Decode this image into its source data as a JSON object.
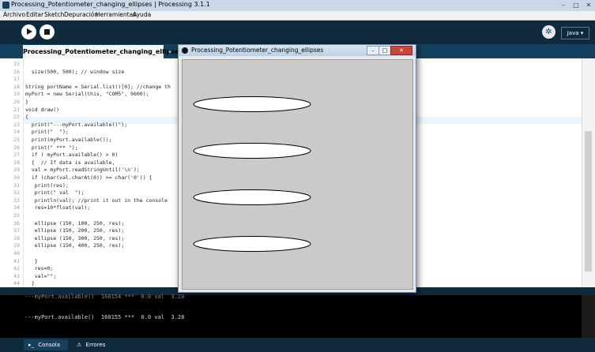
{
  "window": {
    "title": "Processing_Potentiometer_changing_ellipses | Processing 3.1.1",
    "min": "–",
    "max": "□",
    "close": "✕"
  },
  "menu": [
    "Archivo",
    "Editar",
    "Sketch",
    "Depuración",
    "Herramientas",
    "Ayuda"
  ],
  "toolbar": {
    "mode": "Java ▾",
    "debug_icon": "butterfly-icon",
    "run_icon": "play-icon",
    "stop_icon": "stop-icon"
  },
  "tabs": {
    "active": "Processing_Potentiometer_changing_ellipses",
    "arrow": "▾"
  },
  "editor": {
    "highlighted_line": "23",
    "lines": [
      {
        "n": "15",
        "code": ""
      },
      {
        "n": "16",
        "code": "  size(500, 500); // window size"
      },
      {
        "n": "17",
        "code": ""
      },
      {
        "n": "18",
        "code": "String portName = Serial.list()[0]; //change th"
      },
      {
        "n": "19",
        "code": "myPort = new Serial(this, \"COM5\", 9600);"
      },
      {
        "n": "20",
        "code": "}"
      },
      {
        "n": "21",
        "code": "void draw()"
      },
      {
        "n": "22",
        "code": "{"
      },
      {
        "n": "23",
        "code": "  print(\"---myPort.available()\");"
      },
      {
        "n": "24",
        "code": "  print(\"  \");"
      },
      {
        "n": "25",
        "code": "  print(myPort.available());"
      },
      {
        "n": "26",
        "code": "  print(\" *** \");"
      },
      {
        "n": "27",
        "code": "  if ( myPort.available() > 0)"
      },
      {
        "n": "28",
        "code": "  {  // If data is available,"
      },
      {
        "n": "29",
        "code": "  val = myPort.readStringUntil('\\n');"
      },
      {
        "n": "30",
        "code": "  if (char(val.charAt(0)) >= char('0')) {"
      },
      {
        "n": "31",
        "code": "   print(res);"
      },
      {
        "n": "32",
        "code": "   print(\" val  \");"
      },
      {
        "n": "33",
        "code": "   println(val); //print it out in the console"
      },
      {
        "n": "34",
        "code": "   res=10*float(val);"
      },
      {
        "n": "35",
        "code": ""
      },
      {
        "n": "36",
        "code": "   ellipse (150, 100, 250, res);"
      },
      {
        "n": "37",
        "code": "   ellipse (150, 200, 250, res);"
      },
      {
        "n": "38",
        "code": "   ellipse (150, 300, 250, res);"
      },
      {
        "n": "39",
        "code": "   ellipse (150, 400, 250, res);"
      },
      {
        "n": "40",
        "code": ""
      },
      {
        "n": "41",
        "code": "   }"
      },
      {
        "n": "42",
        "code": "   res=0;"
      },
      {
        "n": "43",
        "code": "   val=\"\";"
      },
      {
        "n": "44",
        "code": "  }"
      }
    ]
  },
  "console": {
    "partial_line": "---myPort.available()  160154 ***  0.0 val  3.28",
    "line": "---myPort.available()  160155 ***  0.0 val  3.28"
  },
  "bottom_tabs": {
    "console": "Consola",
    "errors": "Errores"
  },
  "sketch_window": {
    "title": "Processing_Potentiometer_changing_ellipses",
    "ellipse_count": 4
  },
  "colors": {
    "ide_dark": "#0e2a3c",
    "tab_blue": "#15415e",
    "canvas_gray": "#cacaca"
  }
}
